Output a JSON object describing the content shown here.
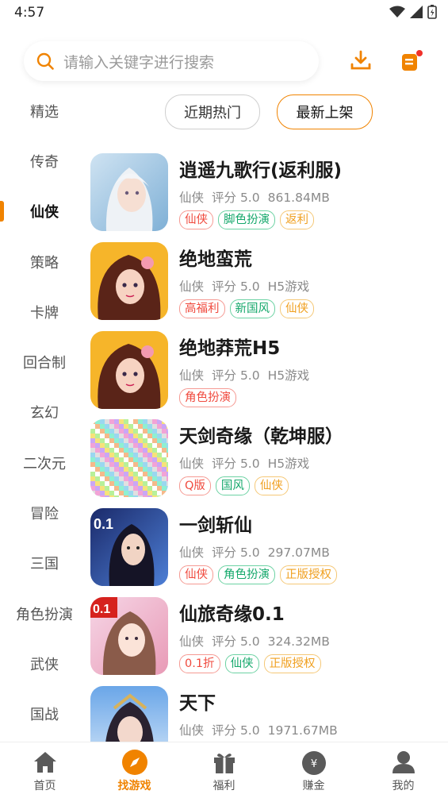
{
  "status": {
    "time": "4:57"
  },
  "search": {
    "placeholder": "请输入关键字进行搜索"
  },
  "sidebar": {
    "items": [
      {
        "label": "精选"
      },
      {
        "label": "传奇"
      },
      {
        "label": "仙侠"
      },
      {
        "label": "策略"
      },
      {
        "label": "卡牌"
      },
      {
        "label": "回合制"
      },
      {
        "label": "玄幻"
      },
      {
        "label": "二次元"
      },
      {
        "label": "冒险"
      },
      {
        "label": "三国"
      },
      {
        "label": "角色扮演"
      },
      {
        "label": "武侠"
      },
      {
        "label": "国战"
      }
    ],
    "active_index": 2
  },
  "filters": {
    "recent_hot": "近期热门",
    "newest": "最新上架"
  },
  "games": [
    {
      "name": "逍遥九歌行(返利服)",
      "genre": "仙侠",
      "rating": "评分 5.0",
      "size": "861.84MB",
      "tags": [
        {
          "text": "仙侠",
          "color": "red"
        },
        {
          "text": "脚色扮演",
          "color": "green"
        },
        {
          "text": "返利",
          "color": "orange"
        }
      ]
    },
    {
      "name": "绝地蛮荒",
      "genre": "仙侠",
      "rating": "评分 5.0",
      "size": "H5游戏",
      "tags": [
        {
          "text": "高福利",
          "color": "red"
        },
        {
          "text": "新国风",
          "color": "green"
        },
        {
          "text": "仙侠",
          "color": "orange"
        }
      ]
    },
    {
      "name": "绝地莽荒H5",
      "genre": "仙侠",
      "rating": "评分 5.0",
      "size": "H5游戏",
      "tags": [
        {
          "text": "角色扮演",
          "color": "red"
        }
      ]
    },
    {
      "name": "天剑奇缘（乾坤服）",
      "genre": "仙侠",
      "rating": "评分 5.0",
      "size": "H5游戏",
      "tags": [
        {
          "text": "Q版",
          "color": "red"
        },
        {
          "text": "国风",
          "color": "green"
        },
        {
          "text": "仙侠",
          "color": "orange"
        }
      ]
    },
    {
      "name": "一剑斩仙",
      "genre": "仙侠",
      "rating": "评分 5.0",
      "size": "297.07MB",
      "tags": [
        {
          "text": "仙侠",
          "color": "red"
        },
        {
          "text": "角色扮演",
          "color": "green"
        },
        {
          "text": "正版授权",
          "color": "orange"
        }
      ]
    },
    {
      "name": "仙旅奇缘0.1",
      "genre": "仙侠",
      "rating": "评分 5.0",
      "size": "324.32MB",
      "tags": [
        {
          "text": "0.1折",
          "color": "red"
        },
        {
          "text": "仙侠",
          "color": "green"
        },
        {
          "text": "正版授权",
          "color": "orange"
        }
      ]
    },
    {
      "name": "天下",
      "genre": "仙侠",
      "rating": "评分 5.0",
      "size": "1971.67MB",
      "tags": []
    }
  ],
  "tabbar": [
    {
      "label": "首页",
      "icon": "home-icon"
    },
    {
      "label": "找游戏",
      "icon": "compass-icon"
    },
    {
      "label": "福利",
      "icon": "gift-icon"
    },
    {
      "label": "赚金",
      "icon": "money-bag-icon"
    },
    {
      "label": "我的",
      "icon": "user-icon"
    }
  ],
  "colors": {
    "accent": "#f08300",
    "tag_red": "#f04a3e",
    "tag_green": "#14a86b",
    "tag_orange": "#f0a020"
  }
}
